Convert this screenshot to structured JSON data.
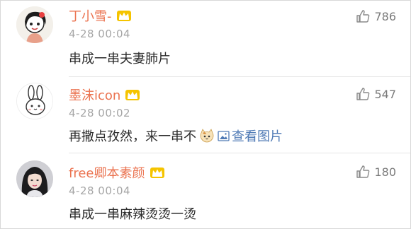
{
  "comments": [
    {
      "username": "丁小雪-",
      "time": "4-28 00:04",
      "text": "串成一串夫妻肺片",
      "likes": "786",
      "avatar": "girl-cartoon-avatar"
    },
    {
      "username": "墨沫icon",
      "time": "4-28 00:02",
      "text": "再撒点孜然，来一串不",
      "link_text": "查看图片",
      "likes": "547",
      "avatar": "rabbit-avatar"
    },
    {
      "username": "free卿本素颜",
      "time": "4-28 00:04",
      "text": "串成一串麻辣烫烫一烫",
      "likes": "180",
      "avatar": "photo-avatar"
    }
  ],
  "colors": {
    "username": "#eb7350",
    "time": "#a6a6a6",
    "link": "#4f7ab5",
    "like": "#7a7a7a",
    "crown": "#f0b400"
  }
}
